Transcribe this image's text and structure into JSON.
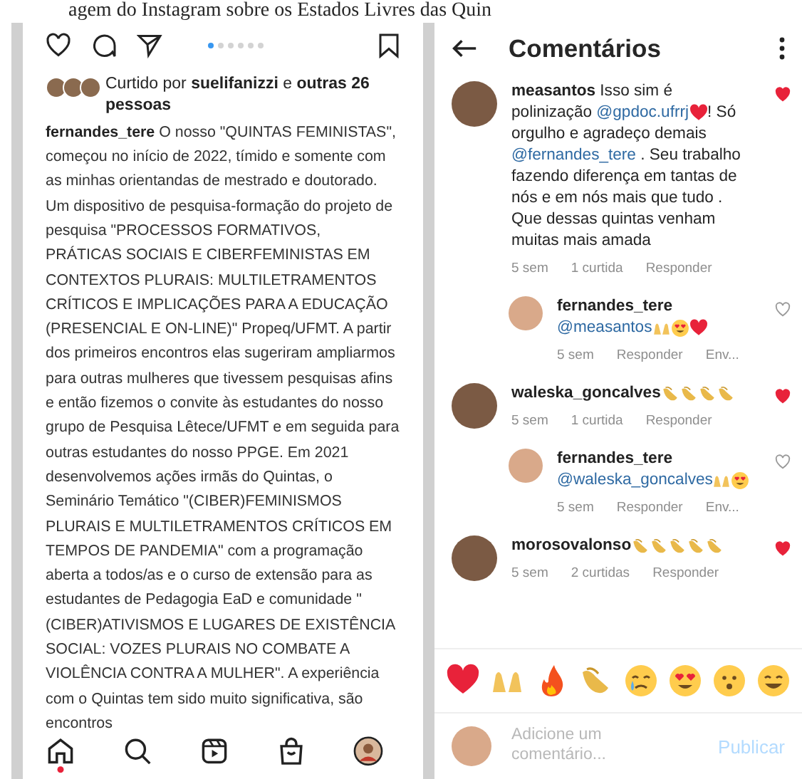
{
  "caption": "agem do Instagram sobre os Estados Livres das Quin",
  "post": {
    "dots": [
      {
        "selected": true
      },
      {
        "selected": false
      },
      {
        "selected": false
      },
      {
        "selected": false
      },
      {
        "selected": false
      },
      {
        "selected": false
      }
    ],
    "likes": [
      {
        "kind": "text",
        "text": "Curtido por "
      },
      {
        "kind": "bold",
        "text": "suelifanizzi"
      },
      {
        "kind": "text",
        "text": " e "
      },
      {
        "kind": "bold",
        "text": "outras 26 pessoas"
      }
    ],
    "author": "fernandes_tere",
    "text": " O nosso \"QUINTAS FEMINISTAS\", começou no início de 2022, tímido e somente com as minhas orientandas de mestrado e doutorado. Um dispositivo de pesquisa-formação do projeto de pesquisa \"PROCESSOS FORMATIVOS, PRÁTICAS SOCIAIS E CIBERFEMINISTAS EM CONTEXTOS PLURAIS: MULTILETRAMENTOS CRÍTICOS E IMPLICAÇÕES PARA A EDUCAÇÃO (PRESENCIAL E ON-LINE)\" Propeq/UFMT. A partir dos primeiros encontros elas sugeriram ampliarmos para outras mulheres que tivessem pesquisas afins e então fizemos o convite às estudantes do nosso grupo de Pesquisa Lêtece/UFMT e em seguida para outras estudantes do nosso PPGE. Em 2021 desenvolvemos ações irmãs do Quintas, o Seminário Temático \"(CIBER)FEMINISMOS PLURAIS E MULTILETRAMENTOS CRÍTICOS EM TEMPOS DE PANDEMIA\" com a programação aberta a todos/as e o curso de extensão para as estudantes de Pedagogia EaD e comunidade \"(CIBER)ATIVISMOS E LUGARES DE EXISTÊNCIA SOCIAL: VOZES PLURAIS NO COMBATE A VIOLÊNCIA CONTRA A MULHER\". A experiência com o Quintas tem sido muito significativa, são encontros",
    "nav": [
      {
        "kind": "home",
        "selected": true
      },
      {
        "kind": "search",
        "selected": false
      },
      {
        "kind": "reels",
        "selected": false
      },
      {
        "kind": "shop",
        "selected": false
      },
      {
        "kind": "profile",
        "selected": false
      }
    ]
  },
  "comments_screen": {
    "title": "Comentários",
    "comments": [
      {
        "user": "measantos",
        "reply": false,
        "liked": true,
        "segments": [
          {
            "kind": "text",
            "text": " Isso sim é polinização "
          },
          {
            "kind": "mention",
            "text": "@gpdoc.ufrrj"
          },
          {
            "kind": "heart"
          },
          {
            "kind": "text",
            "text": "! Só orgulho e agradeço demais "
          },
          {
            "kind": "mention",
            "text": "@fernandes_tere"
          },
          {
            "kind": "text",
            "text": " . Seu trabalho fazendo diferença em tantas de nós e em nós mais que tudo . Que dessas quintas venham muitas mais amada"
          }
        ],
        "time": "5 sem",
        "likes": "1 curtida",
        "reply_label": "Responder"
      },
      {
        "user": "fernandes_tere",
        "reply": true,
        "liked": false,
        "segments": [
          {
            "kind": "mention",
            "text": " @measantos"
          },
          {
            "kind": "raised-hands"
          },
          {
            "kind": "heart-eyes"
          },
          {
            "kind": "heart"
          }
        ],
        "time": "5 sem",
        "reply_label": "Responder",
        "send": "Env..."
      },
      {
        "user": "waleska_goncalves",
        "reply": false,
        "liked": true,
        "segments": [
          {
            "kind": "clap"
          },
          {
            "kind": "clap"
          },
          {
            "kind": "clap"
          },
          {
            "kind": "clap"
          }
        ],
        "time": "5 sem",
        "likes": "1 curtida",
        "reply_label": "Responder"
      },
      {
        "user": "fernandes_tere",
        "reply": true,
        "liked": false,
        "segments": [
          {
            "kind": "mention",
            "text": " @waleska_goncalves"
          },
          {
            "kind": "raised-hands"
          },
          {
            "kind": "heart-eyes"
          }
        ],
        "time": "5 sem",
        "reply_label": "Responder",
        "send": "Env..."
      },
      {
        "user": "morosovalonso",
        "reply": false,
        "liked": true,
        "segments": [
          {
            "kind": "clap"
          },
          {
            "kind": "clap"
          },
          {
            "kind": "clap"
          },
          {
            "kind": "clap"
          },
          {
            "kind": "clap"
          }
        ],
        "time": "5 sem",
        "likes": "2 curtidas",
        "reply_label": "Responder"
      }
    ],
    "reactions": [
      {
        "kind": "heart"
      },
      {
        "kind": "raised-hands"
      },
      {
        "kind": "fire"
      },
      {
        "kind": "clap"
      },
      {
        "kind": "crying"
      },
      {
        "kind": "heart-eyes"
      },
      {
        "kind": "surprised"
      },
      {
        "kind": "laughing"
      }
    ],
    "input": {
      "placeholder": "Adicione um comentário...",
      "action": "Publicar"
    }
  }
}
